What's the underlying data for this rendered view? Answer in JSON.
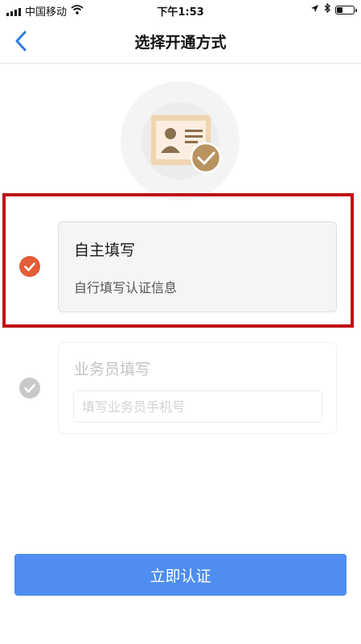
{
  "status_bar": {
    "carrier": "中国移动",
    "time": "下午1:53",
    "battery_level": 0.3
  },
  "nav": {
    "title": "选择开通方式"
  },
  "options": [
    {
      "title": "自主填写",
      "description": "自行填写认证信息",
      "selected": true
    },
    {
      "title": "业务员填写",
      "phone_placeholder": "填写业务员手机号",
      "selected": false
    }
  ],
  "submit": {
    "label": "立即认证"
  },
  "colors": {
    "accent_check": "#e45c3a",
    "primary_button": "#4f8df0",
    "back_arrow": "#2f7ce0",
    "highlight_frame": "#c10d14",
    "icon_gold": "#c9a06a"
  },
  "icons": {
    "back": "chevron-left-icon",
    "hero": "id-card-check-icon",
    "wifi": "wifi-icon",
    "location": "location-arrow-icon",
    "bluetooth": "bluetooth-icon",
    "battery": "battery-icon"
  }
}
